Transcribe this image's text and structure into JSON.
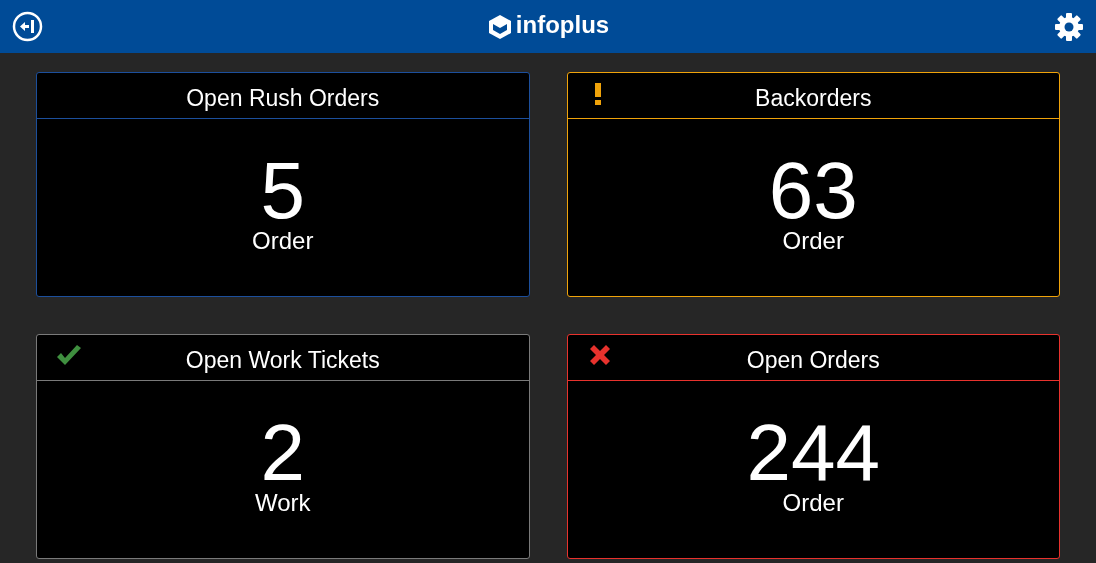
{
  "header": {
    "logo_text": "infoplus"
  },
  "cards": [
    {
      "title": "Open Rush Orders",
      "value": "5",
      "unit": "Order",
      "kind": "plain",
      "color": "#1c4f9c"
    },
    {
      "title": "Backorders",
      "value": "63",
      "unit": "Order",
      "kind": "warning",
      "color": "#f0a30a"
    },
    {
      "title": "Open Work Tickets",
      "value": "2",
      "unit": "Work",
      "kind": "ok",
      "color": "#7a7a7a"
    },
    {
      "title": "Open Orders",
      "value": "244",
      "unit": "Order",
      "kind": "error",
      "color": "#e8322d"
    }
  ]
}
